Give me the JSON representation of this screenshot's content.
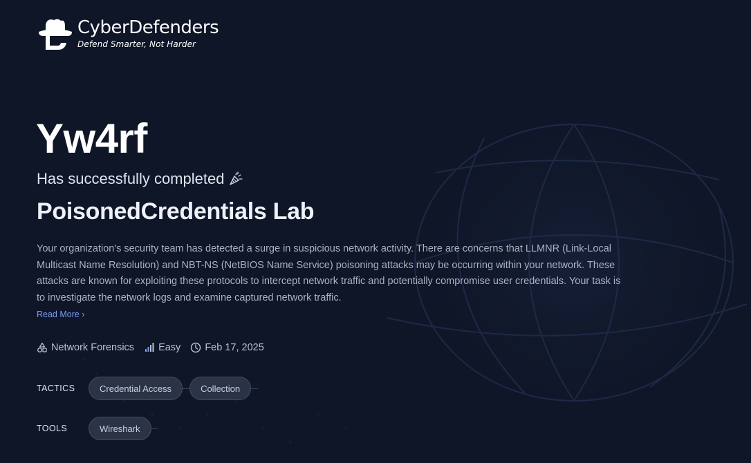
{
  "brand": {
    "name": "CyberDefenders",
    "tagline": "Defend Smarter, Not Harder"
  },
  "certificate": {
    "username": "Yw4rf",
    "completed_text": "Has successfully completed",
    "lab_title": "PoisonedCredentials Lab",
    "description": "Your organization's security team has detected a surge in suspicious network activity. There are concerns that LLMNR (Link-Local Multicast Name Resolution) and NBT-NS (NetBIOS Name Service) poisoning attacks may be occurring within your network. These attacks are known for exploiting these protocols to intercept network traffic and potentially compromise user credentials. Your task is to investigate the network logs and examine captured network traffic.",
    "read_more": "Read More ›"
  },
  "meta": {
    "category": "Network Forensics",
    "difficulty": "Easy",
    "date": "Feb 17, 2025"
  },
  "tactics": {
    "label": "TACTICS",
    "items": [
      "Credential Access",
      "Collection"
    ]
  },
  "tools": {
    "label": "TOOLS",
    "items": [
      "Wireshark"
    ]
  },
  "colors": {
    "background": "#0f1628",
    "accent_link": "#7d9cf3",
    "chip_bg": "#2a3446"
  }
}
